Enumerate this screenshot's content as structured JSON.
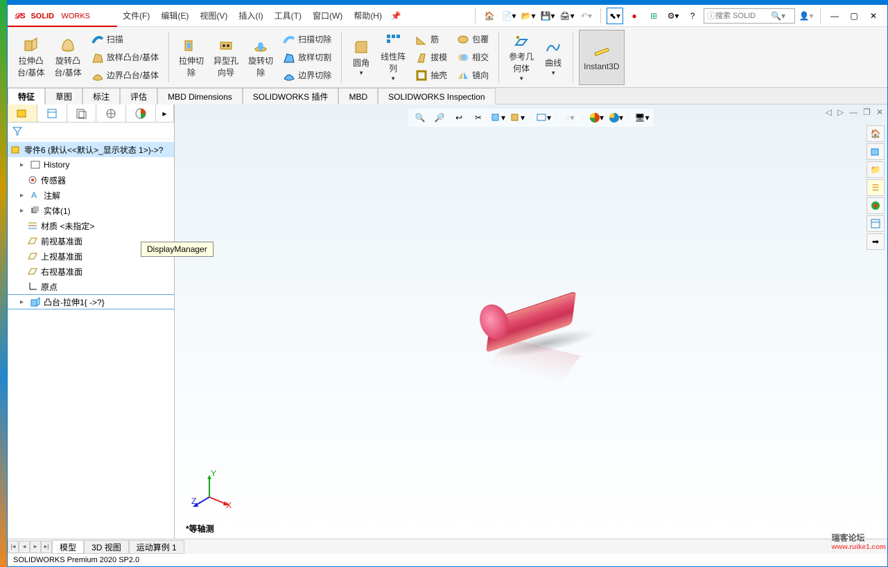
{
  "brand": "SOLIDWORKS",
  "menu": {
    "file": "文件(F)",
    "edit": "编辑(E)",
    "view": "视图(V)",
    "insert": "插入(I)",
    "tools": "工具(T)",
    "window": "窗口(W)",
    "help": "帮助(H)"
  },
  "search": {
    "placeholder": "搜索 SOLID"
  },
  "ribbon": {
    "extrude": "拉伸凸\n台/基体",
    "revolve": "旋转凸\n台/基体",
    "sweep": "扫描",
    "loft_boss": "放样凸台/基体",
    "boundary_boss": "边界凸台/基体",
    "ext_cut": "拉伸切\n除",
    "hole_wizard": "异型孔\n向导",
    "rev_cut": "旋转切\n除",
    "sweep_cut": "扫描切除",
    "loft_cut": "放样切割",
    "boundary_cut": "边界切除",
    "fillet": "圆角",
    "lin_pattern": "线性阵\n列",
    "rib": "筋",
    "draft": "拔模",
    "shell": "抽壳",
    "wrap": "包覆",
    "intersect": "相交",
    "mirror": "镜向",
    "ref_geom": "参考几\n何体",
    "curve": "曲线",
    "instant3d": "Instant3D"
  },
  "tabs": {
    "feature": "特征",
    "sketch": "草图",
    "annotation": "标注",
    "evaluate": "评估",
    "mbd_dim": "MBD Dimensions",
    "plugins": "SOLIDWORKS 插件",
    "mbd": "MBD",
    "inspection": "SOLIDWORKS Inspection"
  },
  "tooltip": "DisplayManager",
  "tree": {
    "root": "零件6 (默认<<默认>_显示状态 1>)->?",
    "history": "History",
    "sensor": "传感器",
    "annotations": "注解",
    "bodies": "实体(1)",
    "material": "材质 <未指定>",
    "front": "前视基准面",
    "top": "上视基准面",
    "right": "右视基准面",
    "origin": "原点",
    "feature1": "凸台-拉伸1{ ->?}"
  },
  "viewlabel": "*等轴测",
  "bottom_tabs": {
    "model": "模型",
    "view3d": "3D 视图",
    "study": "运动算例 1"
  },
  "status": "SOLIDWORKS Premium 2020 SP2.0",
  "watermark": {
    "main": "瑞客论坛",
    "sub": "www.ruike1.com"
  }
}
